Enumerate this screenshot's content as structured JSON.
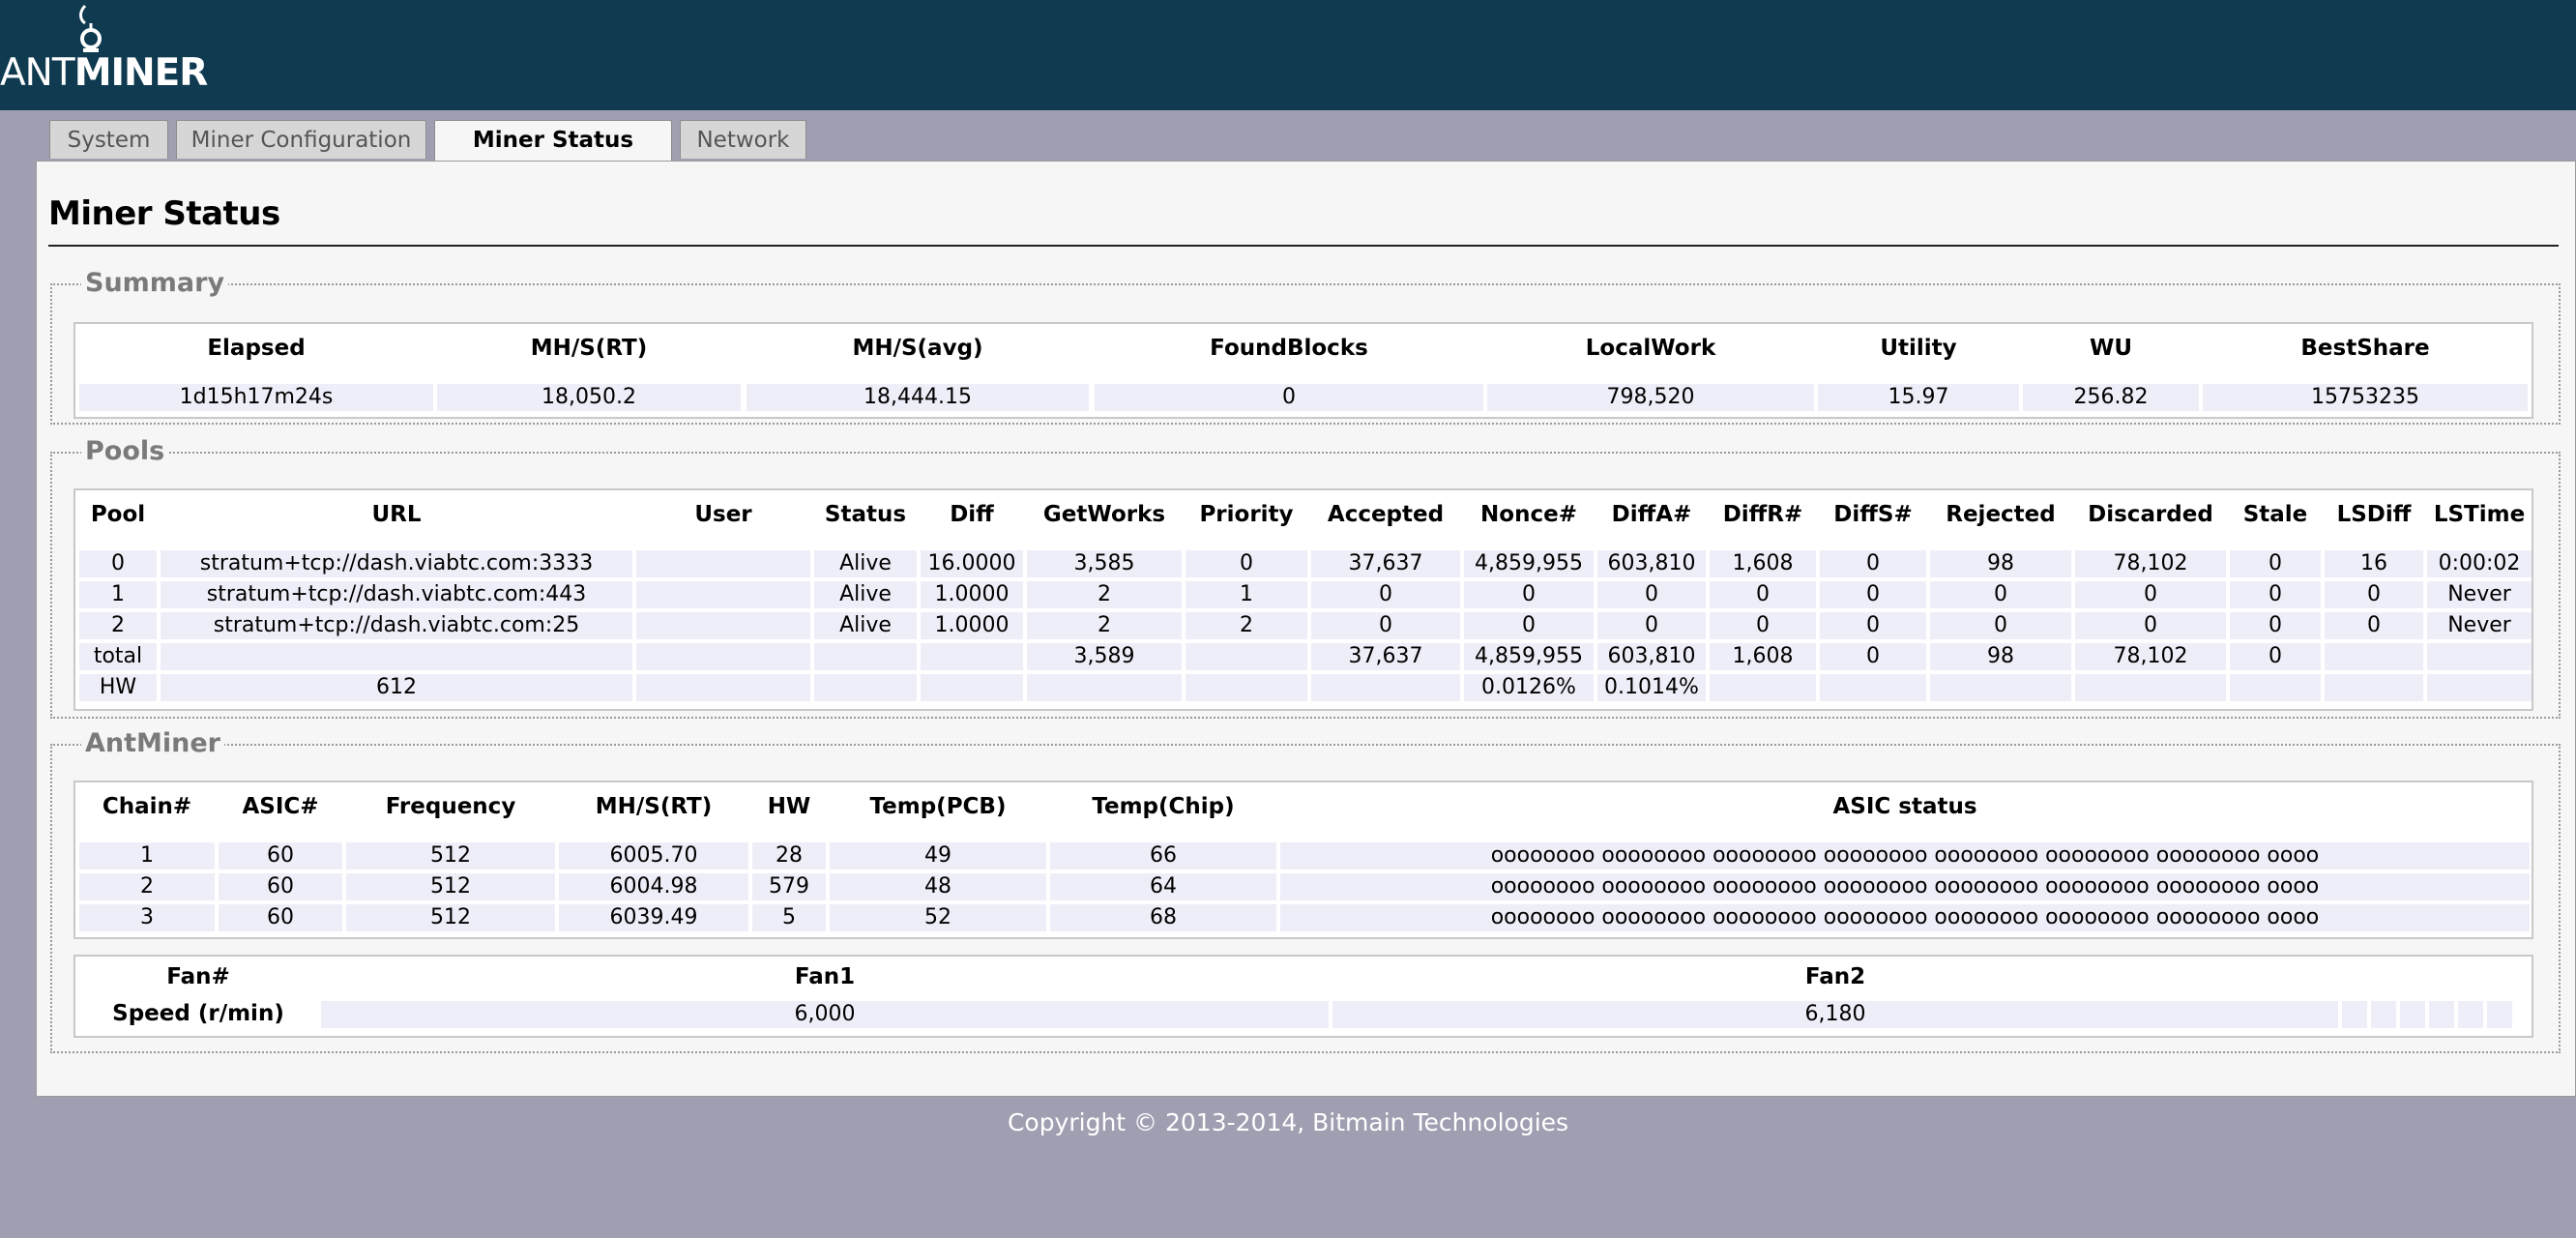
{
  "header": {
    "logo_ant": "ANT",
    "logo_miner": "MINER",
    "logo_icon": "antenna-icon"
  },
  "tabs": [
    {
      "label": "System",
      "active": false
    },
    {
      "label": "Miner Configuration",
      "active": false
    },
    {
      "label": "Miner Status",
      "active": true
    },
    {
      "label": "Network",
      "active": false
    }
  ],
  "page_title": "Miner Status",
  "summary": {
    "legend": "Summary",
    "headers": [
      "Elapsed",
      "MH/S(RT)",
      "MH/S(avg)",
      "FoundBlocks",
      "LocalWork",
      "Utility",
      "WU",
      "BestShare"
    ],
    "values": [
      "1d15h17m24s",
      "18,050.2",
      "18,444.15",
      "0",
      "798,520",
      "15.97",
      "256.82",
      "15753235"
    ]
  },
  "pools": {
    "legend": "Pools",
    "headers": [
      "Pool",
      "URL",
      "User",
      "Status",
      "Diff",
      "GetWorks",
      "Priority",
      "Accepted",
      "Nonce#",
      "DiffA#",
      "DiffR#",
      "DiffS#",
      "Rejected",
      "Discarded",
      "Stale",
      "LSDiff",
      "LSTime"
    ],
    "rows": [
      [
        "0",
        "stratum+tcp://dash.viabtc.com:3333",
        "",
        "Alive",
        "16.0000",
        "3,585",
        "0",
        "37,637",
        "4,859,955",
        "603,810",
        "1,608",
        "0",
        "98",
        "78,102",
        "0",
        "16",
        "0:00:02"
      ],
      [
        "1",
        "stratum+tcp://dash.viabtc.com:443",
        "",
        "Alive",
        "1.0000",
        "2",
        "1",
        "0",
        "0",
        "0",
        "0",
        "0",
        "0",
        "0",
        "0",
        "0",
        "Never"
      ],
      [
        "2",
        "stratum+tcp://dash.viabtc.com:25",
        "",
        "Alive",
        "1.0000",
        "2",
        "2",
        "0",
        "0",
        "0",
        "0",
        "0",
        "0",
        "0",
        "0",
        "0",
        "Never"
      ],
      [
        "total",
        "",
        "",
        "",
        "",
        "3,589",
        "",
        "37,637",
        "4,859,955",
        "603,810",
        "1,608",
        "0",
        "98",
        "78,102",
        "0",
        "",
        ""
      ],
      [
        "HW",
        "612",
        "",
        "",
        "",
        "",
        "",
        "",
        "0.0126%",
        "0.1014%",
        "",
        "",
        "",
        "",
        "",
        "",
        ""
      ]
    ]
  },
  "antminer": {
    "legend": "AntMiner",
    "headers": [
      "Chain#",
      "ASIC#",
      "Frequency",
      "MH/S(RT)",
      "HW",
      "Temp(PCB)",
      "Temp(Chip)",
      "ASIC status"
    ],
    "rows": [
      [
        "1",
        "60",
        "512",
        "6005.70",
        "28",
        "49",
        "66",
        "oooooooo oooooooo oooooooo oooooooo oooooooo oooooooo oooooooo oooo"
      ],
      [
        "2",
        "60",
        "512",
        "6004.98",
        "579",
        "48",
        "64",
        "oooooooo oooooooo oooooooo oooooooo oooooooo oooooooo oooooooo oooo"
      ],
      [
        "3",
        "60",
        "512",
        "6039.49",
        "5",
        "52",
        "68",
        "oooooooo oooooooo oooooooo oooooooo oooooooo oooooooo oooooooo oooo"
      ]
    ]
  },
  "fans": {
    "headers": [
      "Fan#",
      "Fan1",
      "Fan2"
    ],
    "row_label": "Speed (r/min)",
    "values": [
      "6,000",
      "6,180"
    ]
  },
  "footer": "Copyright © 2013-2014, Bitmain Technologies"
}
